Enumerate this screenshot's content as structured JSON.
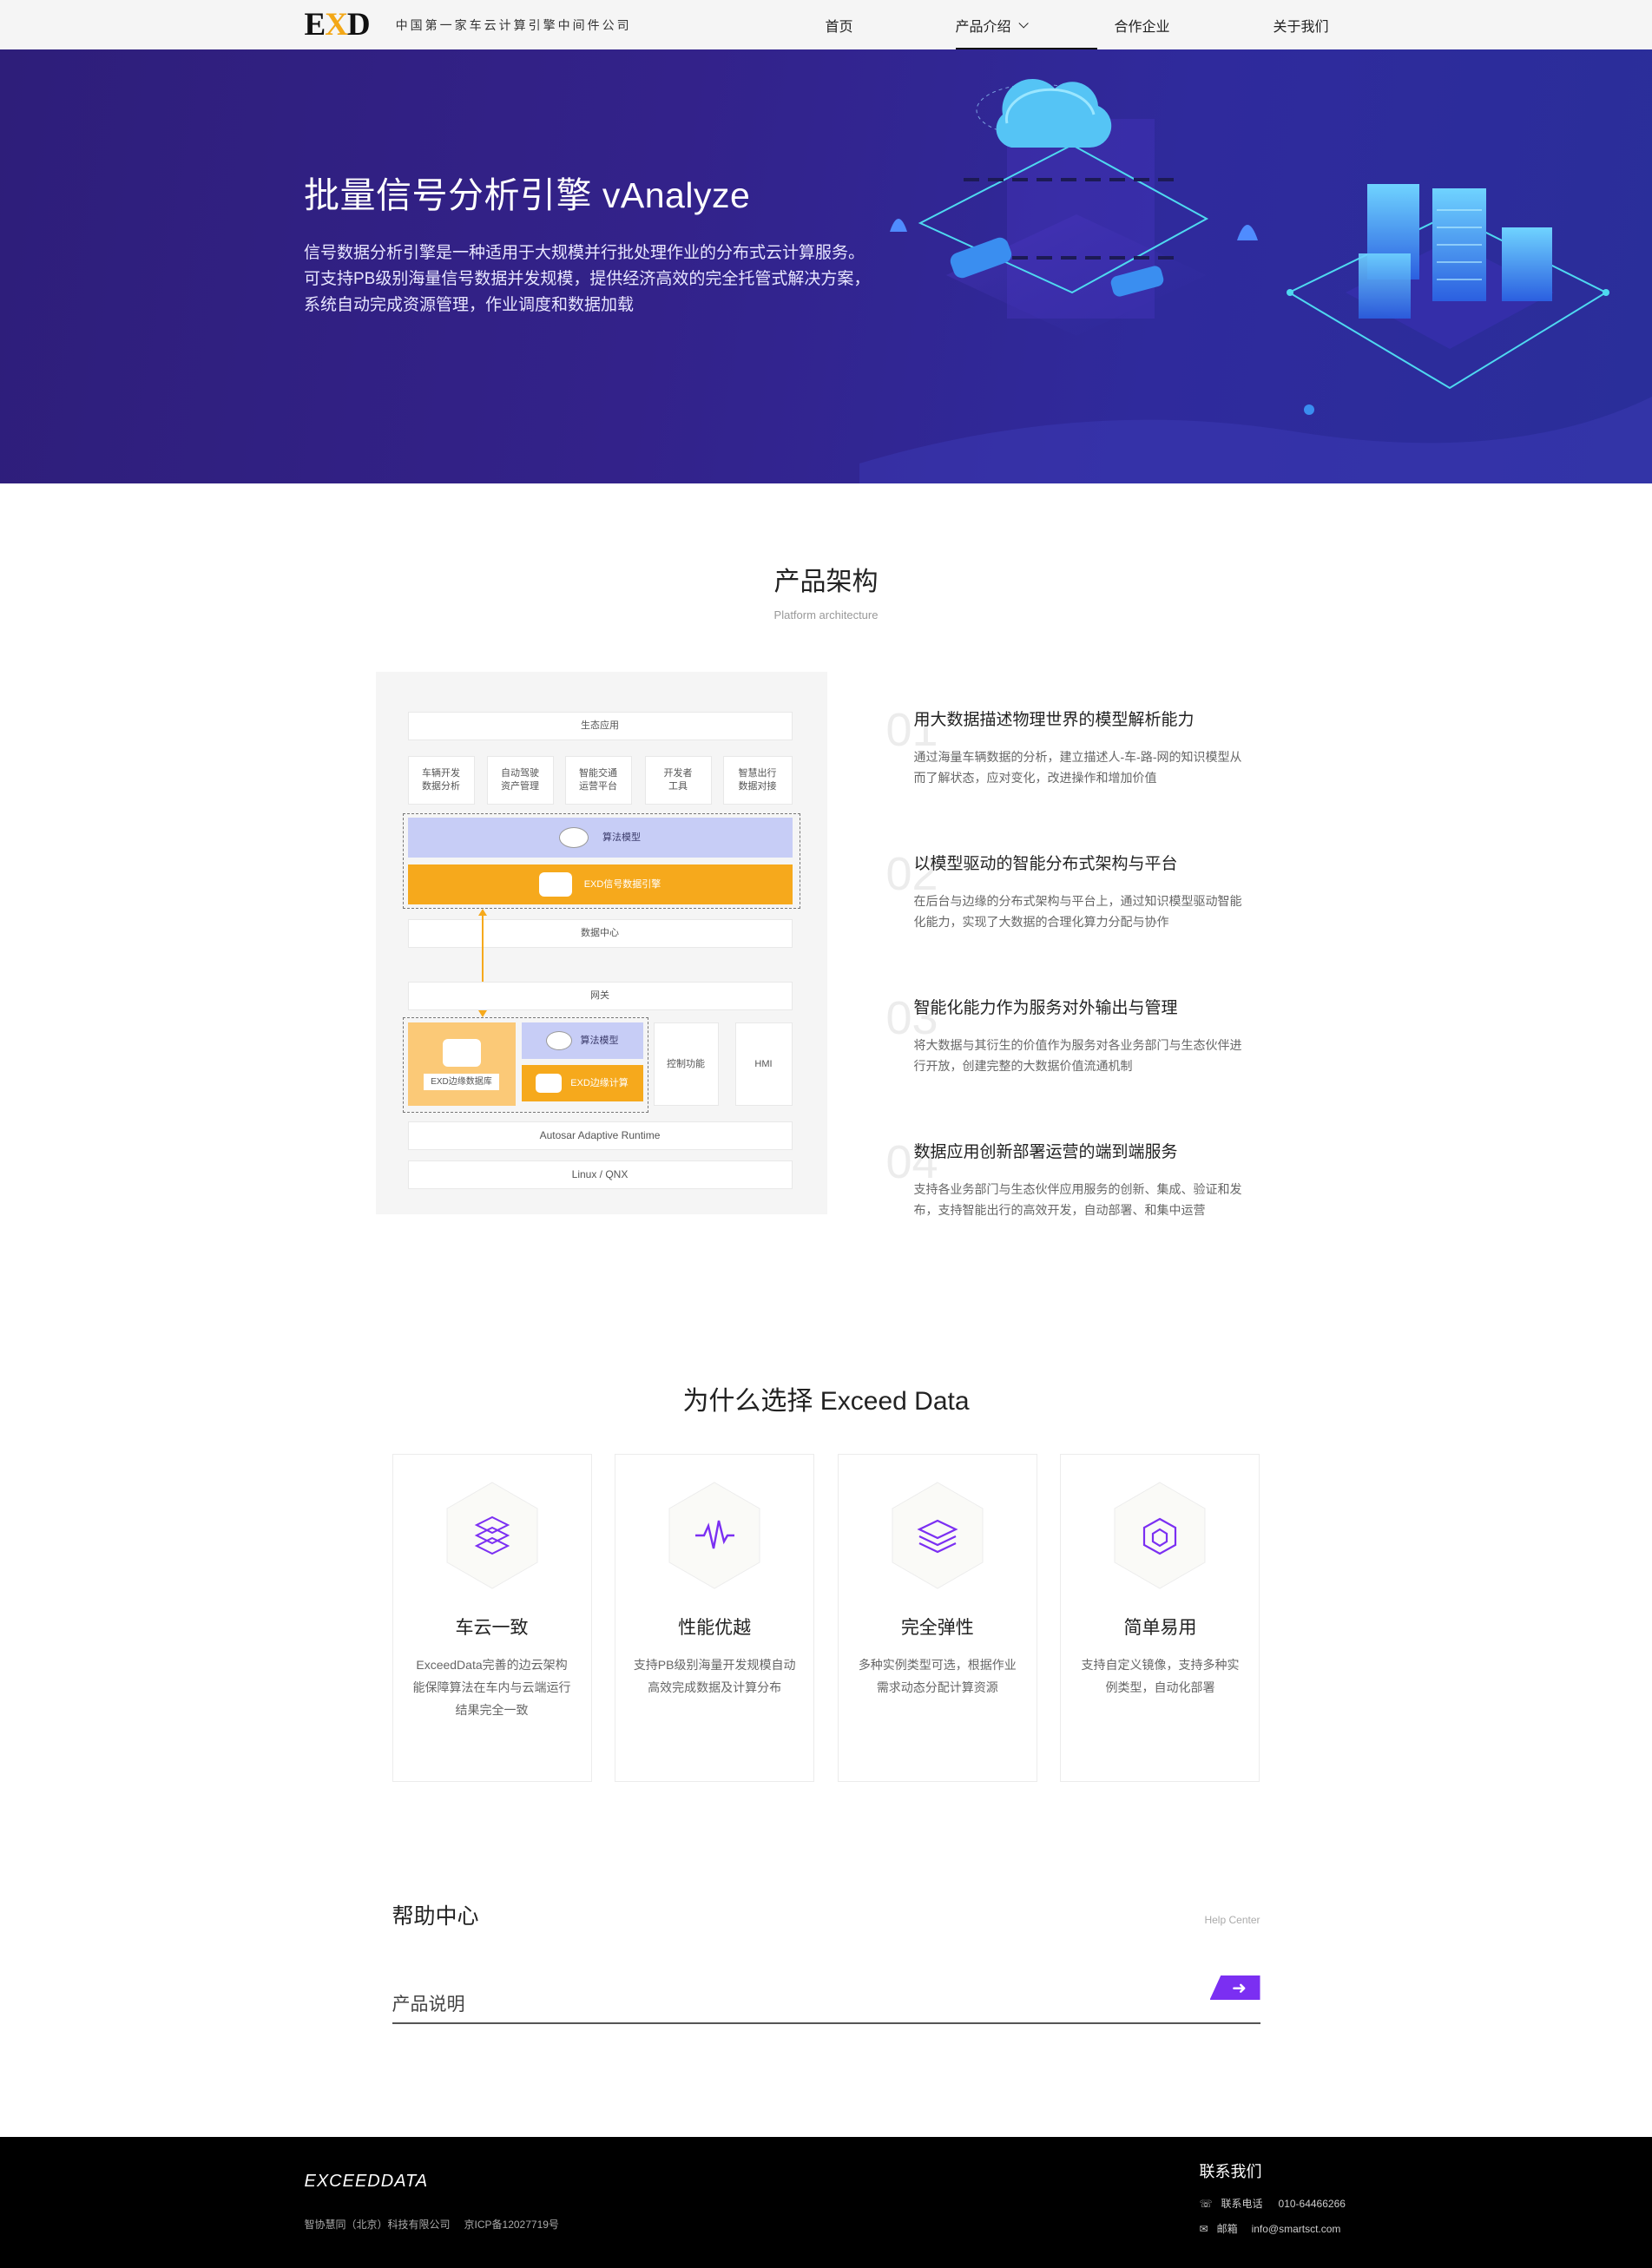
{
  "header": {
    "logo_e": "E",
    "logo_x": "X",
    "logo_d": "D",
    "tagline": "中国第一家车云计算引擎中间件公司",
    "nav": [
      {
        "label": "首页"
      },
      {
        "label": "产品介绍"
      },
      {
        "label": "合作企业"
      },
      {
        "label": "关于我们"
      }
    ]
  },
  "hero": {
    "title": "批量信号分析引擎 vAnalyze",
    "description": "信号数据分析引擎是一种适用于大规模并行批处理作业的分布式云计算服务。可支持PB级别海量信号数据并发规模，提供经济高效的完全托管式解决方案，系统自动完成资源管理，作业调度和数据加载"
  },
  "architecture": {
    "title": "产品架构",
    "subtitle": "Platform architecture",
    "diagram": {
      "eco_app": "生态应用",
      "apps": [
        "车辆开发数据分析",
        "自动驾驶资产管理",
        "智能交通运营平台",
        "开发者工具",
        "智慧出行数据对接"
      ],
      "algo_model": "算法模型",
      "engine": "EXD信号数据引擎",
      "data_center": "数据中心",
      "gateway": "网关",
      "edge_db": "EXD边缘数据库",
      "edge_algo": "算法模型",
      "edge_compute": "EXD边缘计算",
      "control": "控制功能",
      "hmi": "HMI",
      "runtime": "Autosar Adaptive Runtime",
      "os": "Linux / QNX"
    },
    "features": [
      {
        "num": "01",
        "title": "用大数据描述物理世界的模型解析能力",
        "desc": "通过海量车辆数据的分析，建立描述人-车-路-网的知识模型从而了解状态，应对变化，改进操作和增加价值"
      },
      {
        "num": "02",
        "title": "以模型驱动的智能分布式架构与平台",
        "desc": "在后台与边缘的分布式架构与平台上，通过知识模型驱动智能化能力，实现了大数据的合理化算力分配与协作"
      },
      {
        "num": "03",
        "title": "智能化能力作为服务对外输出与管理",
        "desc": "将大数据与其衍生的价值作为服务对各业务部门与生态伙伴进行开放，创建完整的大数据价值流通机制"
      },
      {
        "num": "04",
        "title": "数据应用创新部署运营的端到端服务",
        "desc": "支持各业务部门与生态伙伴应用服务的创新、集成、验证和发布，支持智能出行的高效开发，自动部署、和集中运营"
      }
    ]
  },
  "why": {
    "title": "为什么选择 Exceed Data",
    "cards": [
      {
        "title": "车云一致",
        "desc": "ExceedData完善的边云架构能保障算法在车内与云端运行结果完全一致",
        "icon": "boxes-icon"
      },
      {
        "title": "性能优越",
        "desc": "支持PB级别海量开发规模自动高效完成数据及计算分布",
        "icon": "pulse-icon"
      },
      {
        "title": "完全弹性",
        "desc": "多种实例类型可选，根据作业需求动态分配计算资源",
        "icon": "layers-icon"
      },
      {
        "title": "简单易用",
        "desc": "支持自定义镜像，支持多种实例类型，自动化部署",
        "icon": "cube-icon"
      }
    ]
  },
  "help": {
    "title": "帮助中心",
    "subtitle": "Help Center",
    "item": "产品说明"
  },
  "footer": {
    "logo": "EXCEEDDATA",
    "company": "智协慧同（北京）科技有限公司",
    "icp": "京ICP备12027719号",
    "contact_title": "联系我们",
    "phone_label": "联系电话",
    "phone": "010-64466266",
    "email_label": "邮箱",
    "email": "info@smartsct.com"
  },
  "colors": {
    "accent": "#7b2ff2",
    "hero_bg": "#33228a",
    "engine_orange": "#f6a91c",
    "algo_purple": "#c7cdf6"
  }
}
